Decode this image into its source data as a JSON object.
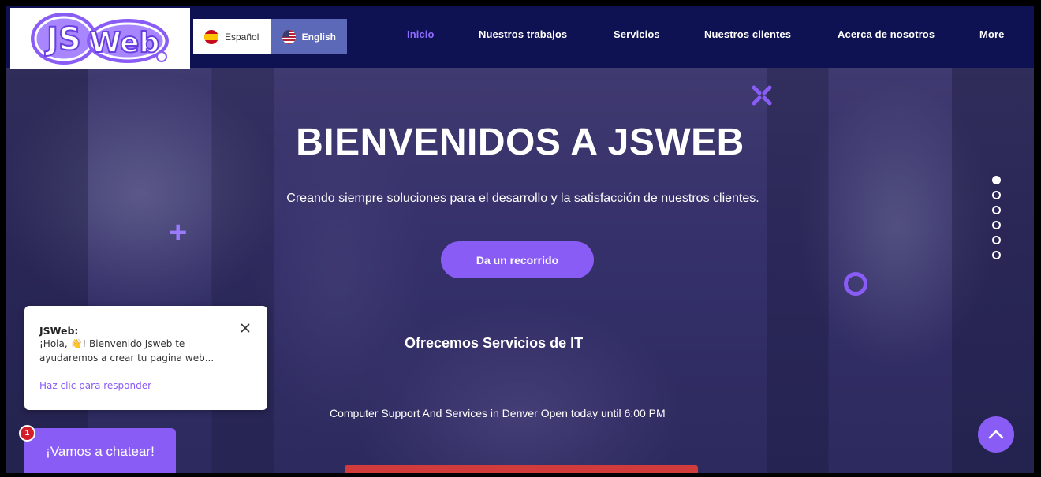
{
  "brand": {
    "logo_text": "JSWeb",
    "accent": "#8a5cf6",
    "nav_bg": "#0e1152"
  },
  "languages": [
    {
      "label": "Español",
      "flag": "spain-flag-icon",
      "active": false
    },
    {
      "label": "English",
      "flag": "usa-flag-icon",
      "active": true
    }
  ],
  "nav": {
    "items": [
      {
        "label": "Inicio",
        "active": true
      },
      {
        "label": "Nuestros trabajos"
      },
      {
        "label": "Servicios"
      },
      {
        "label": "Nuestros clientes"
      },
      {
        "label": "Acerca de nosotros"
      },
      {
        "label": "More"
      }
    ]
  },
  "hero": {
    "title": "BIENVENIDOS A JSWEB",
    "subtitle": "Creando siempre soluciones para el desarrollo y la satisfacción de nuestros clientes.",
    "cta_label": "Da un recorrido",
    "services_heading": "Ofrecemos Servicios de IT",
    "support_line": "Computer Support And Services in Denver Open today until 6:00 PM"
  },
  "slider": {
    "count": 6,
    "active_index": 0
  },
  "chat": {
    "sender": "JSWeb:",
    "message": "¡Hola, 👋! Bienvenido Jsweb te ayudaremos a crear tu pagina web...",
    "reply_label": "Haz clic para responder",
    "button_label": "¡Vamos a chatear!",
    "badge_count": "1"
  }
}
